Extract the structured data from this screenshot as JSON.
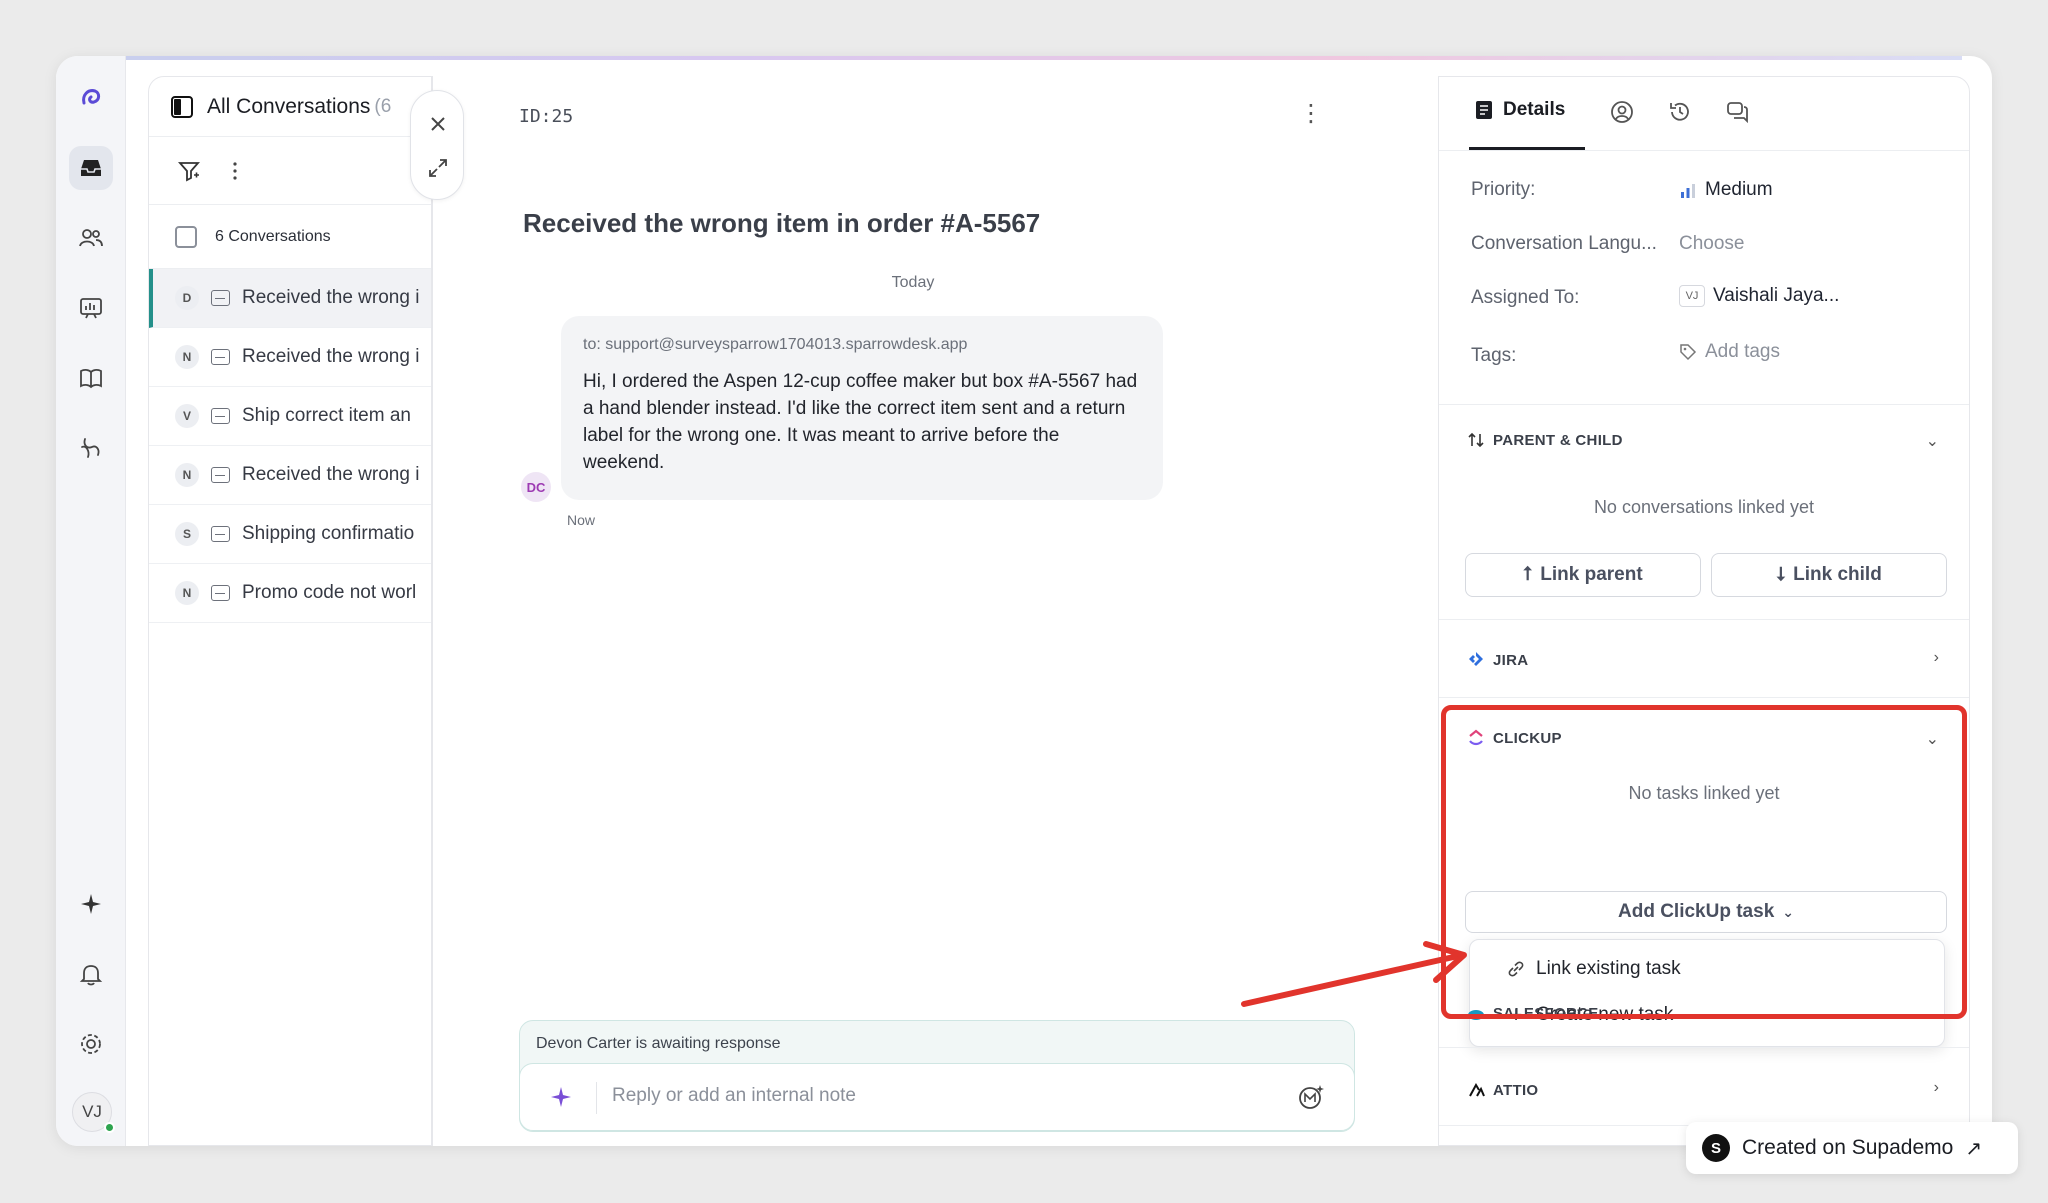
{
  "nav": {
    "items": [
      "inbox",
      "contacts",
      "reports",
      "knowledge-base",
      "automation"
    ],
    "bottom": [
      "ai",
      "notifications",
      "settings"
    ],
    "user_initials": "VJ"
  },
  "list": {
    "title": "All Conversations",
    "count": "(6",
    "select_label": "6 Conversations",
    "rows": [
      {
        "initial": "D",
        "text": "Received the wrong i",
        "active": true
      },
      {
        "initial": "N",
        "text": "Received the wrong i"
      },
      {
        "initial": "V",
        "text": "Ship correct item an"
      },
      {
        "initial": "N",
        "text": "Received the wrong i"
      },
      {
        "initial": "S",
        "text": "Shipping confirmatio"
      },
      {
        "initial": "N",
        "text": "Promo code not worl"
      }
    ]
  },
  "conversation": {
    "id": "ID:25",
    "subject": "Received the wrong item in order #A-5567",
    "day": "Today",
    "to": "to: support@surveysparrow1704013.sparrowdesk.app",
    "message": "Hi, I ordered the Aspen 12-cup coffee maker but box #A-5567 had a hand blender instead. I'd like the correct item sent and a return label for the wrong one. It was meant to arrive before the weekend.",
    "sender_initials": "DC",
    "time": "Now",
    "awaiting": "Devon Carter is awaiting response",
    "reply_placeholder": "Reply or add an internal note"
  },
  "details": {
    "tab_label": "Details",
    "priority_label": "Priority:",
    "priority_value": "Medium",
    "language_label": "Conversation Langu...",
    "language_value": "Choose",
    "assigned_label": "Assigned To:",
    "assigned_initials": "VJ",
    "assigned_value": "Vaishali Jaya...",
    "tags_label": "Tags:",
    "tags_value": "Add tags",
    "parent_child": "PARENT & CHILD",
    "no_conversations": "No conversations linked yet",
    "link_parent": "Link parent",
    "link_child": "Link child",
    "jira": "JIRA",
    "clickup": "CLICKUP",
    "no_tasks": "No tasks linked yet",
    "add_task": "Add ClickUp task",
    "menu": [
      "Link existing task",
      "Create new task"
    ],
    "salesforce": "SALESFORCE",
    "attio": "ATTIO"
  },
  "badge": {
    "logo_letter": "S",
    "text": "Created on Supademo"
  },
  "colors": {
    "accent_teal": "#24908a",
    "highlight_red": "#e1342c",
    "sender_purple": "#9d3bb3"
  }
}
